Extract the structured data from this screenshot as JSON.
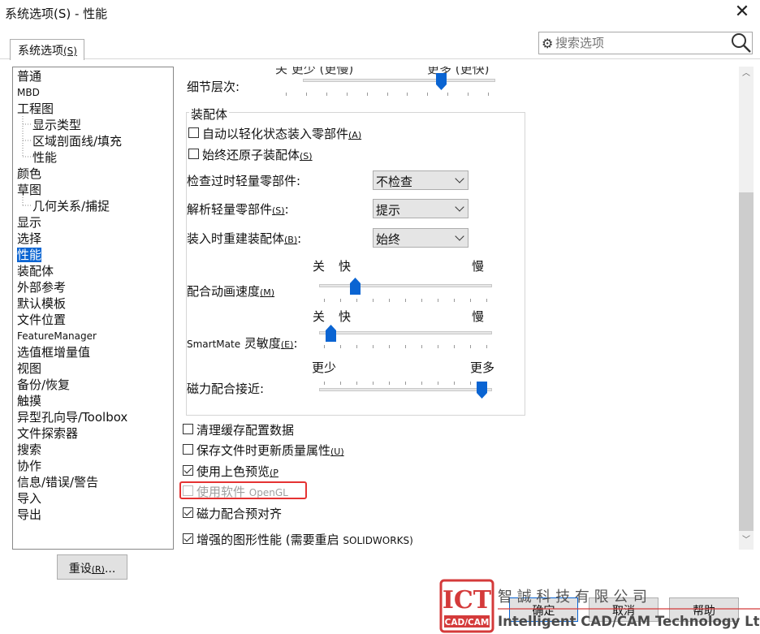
{
  "window": {
    "title": "系统选项(S) - 性能",
    "close_glyph": "✕"
  },
  "tab": {
    "label": "系统选项",
    "mnemonic": "(S)"
  },
  "search": {
    "placeholder": "搜索选项"
  },
  "tree": {
    "items": [
      {
        "label": "普通",
        "indent": 0,
        "small": false
      },
      {
        "label": "MBD",
        "indent": 0,
        "small": true
      },
      {
        "label": "工程图",
        "indent": 0,
        "small": false
      },
      {
        "label": "显示类型",
        "indent": 1,
        "small": false
      },
      {
        "label": "区域剖面线/填充",
        "indent": 1,
        "small": false
      },
      {
        "label": "性能",
        "indent": 1,
        "small": false
      },
      {
        "label": "颜色",
        "indent": 0,
        "small": false
      },
      {
        "label": "草图",
        "indent": 0,
        "small": false
      },
      {
        "label": "几何关系/捕捉",
        "indent": 1,
        "small": false
      },
      {
        "label": "显示",
        "indent": 0,
        "small": false
      },
      {
        "label": "选择",
        "indent": 0,
        "small": false
      },
      {
        "label": "性能",
        "indent": 0,
        "small": false,
        "selected": true
      },
      {
        "label": "装配体",
        "indent": 0,
        "small": false
      },
      {
        "label": "外部参考",
        "indent": 0,
        "small": false
      },
      {
        "label": "默认模板",
        "indent": 0,
        "small": false
      },
      {
        "label": "文件位置",
        "indent": 0,
        "small": false
      },
      {
        "label": "FeatureManager",
        "indent": 0,
        "small": true
      },
      {
        "label": "选值框增量值",
        "indent": 0,
        "small": false
      },
      {
        "label": "视图",
        "indent": 0,
        "small": false
      },
      {
        "label": "备份/恢复",
        "indent": 0,
        "small": false
      },
      {
        "label": "触摸",
        "indent": 0,
        "small": false
      },
      {
        "label": "异型孔向导/Toolbox",
        "indent": 0,
        "small": false
      },
      {
        "label": "文件探索器",
        "indent": 0,
        "small": false
      },
      {
        "label": "搜索",
        "indent": 0,
        "small": false
      },
      {
        "label": "协作",
        "indent": 0,
        "small": false
      },
      {
        "label": "信息/错误/警告",
        "indent": 0,
        "small": false
      },
      {
        "label": "导入",
        "indent": 0,
        "small": false
      },
      {
        "label": "导出",
        "indent": 0,
        "small": false
      }
    ]
  },
  "reset_button": {
    "label": "重设",
    "mnemonic": "(R)",
    "suffix": "..."
  },
  "content": {
    "top_slider": {
      "clipped_left": "关 更少 (更慢)",
      "clipped_right": "更多 (更快)",
      "label": "细节层次:",
      "value_fraction": 0.72
    },
    "assembly_group": {
      "title": "装配体",
      "check_lightweight": {
        "label": "自动以轻化状态装入零部件",
        "mnemonic": "(A)",
        "checked": false
      },
      "check_restore": {
        "label": "始终还原子装配体",
        "mnemonic": "(S)",
        "checked": false
      },
      "check_stale": {
        "label": "检查过时轻量零部件:",
        "value": "不检查"
      },
      "resolve": {
        "label": "解析轻量零部件",
        "mnemonic": "(S)",
        "colon": ":",
        "value": "提示"
      },
      "rebuild": {
        "label": "装入时重建装配体",
        "mnemonic": "(B)",
        "colon": ":",
        "value": "始终"
      },
      "mate_anim": {
        "label": "配合动画速度",
        "mnemonic": "(M)",
        "off": "关",
        "fast": "快",
        "slow": "慢",
        "value_fraction": 0.19
      },
      "smartmate": {
        "label_latin": "SmartMate",
        "label": "灵敏度",
        "mnemonic": "(E)",
        "colon": ":",
        "off": "关",
        "fast": "快",
        "slow": "慢",
        "value_fraction": 0.04
      },
      "magnetic": {
        "label": "磁力配合接近:",
        "less": "更少",
        "more": "更多",
        "value_fraction": 0.97
      }
    },
    "check_cache": {
      "label": "清理缓存配置数据",
      "checked": false
    },
    "check_quality": {
      "label": "保存文件时更新质量属性",
      "mnemonic": "(U)",
      "checked": false
    },
    "check_preview": {
      "label": "使用上色预览",
      "mnemonic": "(P",
      "checked": true
    },
    "check_opengl": {
      "label": "使用软件",
      "label_latin": "OpenGL",
      "checked": false,
      "disabled": true
    },
    "check_prealign": {
      "label": "磁力配合预对齐",
      "checked": true
    },
    "check_enhanced": {
      "label": "增强的图形性能 (需要重启",
      "label_latin": "SOLIDWORKS)",
      "checked": true
    }
  },
  "buttons": {
    "ok": "确定",
    "cancel": "取消",
    "help": "帮助"
  },
  "watermark": {
    "logo_big": "ICT",
    "logo_small": "CAD/CAM",
    "company_cn": "智 誠 科 技 有 限 公 司",
    "company_en": "Intelligent CAD/CAM Technology Ltd.",
    "red": "#d43a3a"
  },
  "colors": {
    "accent": "#0a64d2",
    "highlight_box": "#e53232"
  }
}
